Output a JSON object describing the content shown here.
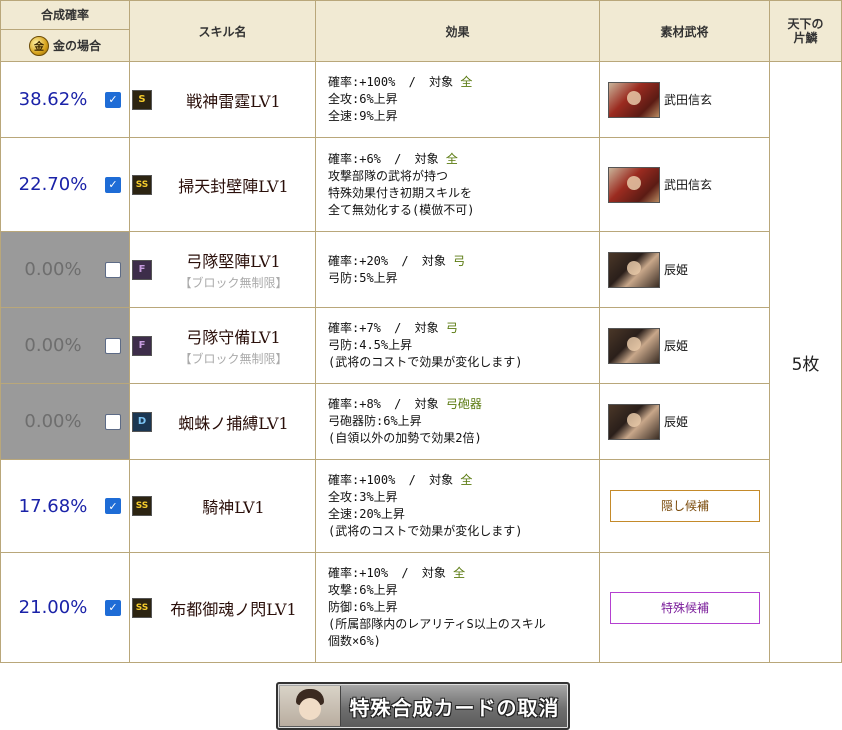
{
  "header": {
    "rate_title": "合成確率",
    "rate_sub": "金の場合",
    "coin_glyph": "金",
    "skill_col": "スキル名",
    "effect_col": "効果",
    "material_col": "素材武将",
    "tenka_col_line1": "天下の",
    "tenka_col_line2": "片鱗"
  },
  "tenka_count": "5枚",
  "rows": [
    {
      "rate": "38.62%",
      "checked": true,
      "disabled": false,
      "rank": "S",
      "skill": "戦神雷霆LV1",
      "note": "",
      "effect": {
        "rate_text": "確率:+100%",
        "sep": "/",
        "target_label": "対象",
        "target": "全",
        "lines": [
          "全攻:6%上昇",
          "全速:9%上昇"
        ]
      },
      "material": {
        "type": "portrait",
        "portrait": "shingen",
        "name": "武田信玄"
      }
    },
    {
      "rate": "22.70%",
      "checked": true,
      "disabled": false,
      "rank": "SS",
      "skill": "掃天封壁陣LV1",
      "note": "",
      "effect": {
        "rate_text": "確率:+6%",
        "sep": "/",
        "target_label": "対象",
        "target": "全",
        "lines": [
          "攻撃部隊の武将が持つ",
          "特殊効果付き初期スキルを",
          "全て無効化する(模倣不可)"
        ]
      },
      "material": {
        "type": "portrait",
        "portrait": "shingen",
        "name": "武田信玄"
      }
    },
    {
      "rate": "0.00%",
      "checked": false,
      "disabled": true,
      "rank": "F",
      "skill": "弓隊堅陣LV1",
      "note": "【ブロック無制限】",
      "effect": {
        "rate_text": "確率:+20%",
        "sep": "/",
        "target_label": "対象",
        "target": "弓",
        "lines": [
          "弓防:5%上昇"
        ]
      },
      "material": {
        "type": "portrait",
        "portrait": "tatsuhime",
        "name": "辰姫"
      }
    },
    {
      "rate": "0.00%",
      "checked": false,
      "disabled": true,
      "rank": "F",
      "skill": "弓隊守備LV1",
      "note": "【ブロック無制限】",
      "effect": {
        "rate_text": "確率:+7%",
        "sep": "/",
        "target_label": "対象",
        "target": "弓",
        "lines": [
          "弓防:4.5%上昇",
          "(武将のコストで効果が変化します)"
        ]
      },
      "material": {
        "type": "portrait",
        "portrait": "tatsuhime",
        "name": "辰姫"
      }
    },
    {
      "rate": "0.00%",
      "checked": false,
      "disabled": true,
      "rank": "D",
      "skill": "蜘蛛ノ捕縛LV1",
      "note": "",
      "effect": {
        "rate_text": "確率:+8%",
        "sep": "/",
        "target_label": "対象",
        "target": "弓砲器",
        "lines": [
          "弓砲器防:6%上昇",
          "(自領以外の加勢で効果2倍)"
        ]
      },
      "material": {
        "type": "portrait",
        "portrait": "tatsuhime",
        "name": "辰姫"
      }
    },
    {
      "rate": "17.68%",
      "checked": true,
      "disabled": false,
      "rank": "SS",
      "skill": "騎神LV1",
      "note": "",
      "effect": {
        "rate_text": "確率:+100%",
        "sep": "/",
        "target_label": "対象",
        "target": "全",
        "lines": [
          "全攻:3%上昇",
          "全速:20%上昇",
          "(武将のコストで効果が変化します)"
        ]
      },
      "material": {
        "type": "button",
        "style": "kakushi",
        "label": "隠し候補"
      }
    },
    {
      "rate": "21.00%",
      "checked": true,
      "disabled": false,
      "rank": "SS",
      "skill": "布都御魂ノ閃LV1",
      "note": "",
      "effect": {
        "rate_text": "確率:+10%",
        "sep": "/",
        "target_label": "対象",
        "target": "全",
        "lines": [
          "攻撃:6%上昇",
          "防御:6%上昇",
          "(所属部隊内のレアリティS以上のスキル",
          "個数×6%)"
        ]
      },
      "material": {
        "type": "button",
        "style": "tokushu",
        "label": "特殊候補"
      }
    }
  ],
  "cancel_button": {
    "label": "特殊合成カードの取消"
  }
}
